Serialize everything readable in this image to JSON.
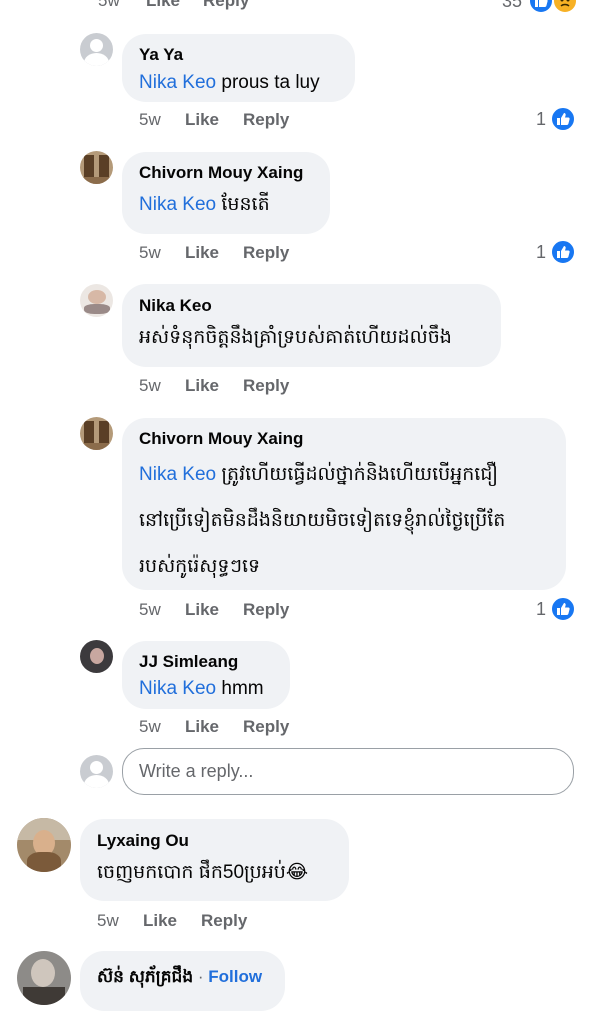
{
  "top_row": {
    "time": "5w",
    "like": "Like",
    "reply": "Reply",
    "count": "35",
    "reactions": [
      "like-icon",
      "sad-icon"
    ]
  },
  "comments": [
    {
      "name": "Ya Ya",
      "mention": "Nika Keo",
      "text": "prous ta luy",
      "time": "5w",
      "like": "Like",
      "reply": "Reply",
      "likes": "1",
      "avatar": "placeholder-avatar"
    },
    {
      "name": "Chivorn Mouy Xaing",
      "mention": "Nika Keo",
      "text": "មែនតើ",
      "time": "5w",
      "like": "Like",
      "reply": "Reply",
      "likes": "1",
      "avatar": "photo-avatar"
    },
    {
      "name": "Nika Keo",
      "mention": "",
      "text": "អស់ទំនុកចិត្តនឹងគ្រាំទ្របស់គាត់ហើយដល់ចឹង",
      "time": "5w",
      "like": "Like",
      "reply": "Reply",
      "likes": "",
      "avatar": "photo-avatar"
    },
    {
      "name": "Chivorn Mouy Xaing",
      "mention": "Nika Keo",
      "text_lines": [
        "ត្រូវហើយធ្វើដល់ថ្នាក់និងហើយបើអ្នកជឿ",
        "នៅប្រើទៀតមិនដឹងនិយាយមិចទៀតទេខ្ញុំរាល់ថ្ងៃប្រើតែ",
        "របស់កូរ៉េសុទ្ធៗទេ"
      ],
      "time": "5w",
      "like": "Like",
      "reply": "Reply",
      "likes": "1",
      "avatar": "photo-avatar"
    },
    {
      "name": "JJ Simleang",
      "mention": "Nika Keo",
      "text": "hmm",
      "time": "5w",
      "like": "Like",
      "reply": "Reply",
      "likes": "",
      "avatar": "photo-avatar"
    }
  ],
  "reply_box": {
    "placeholder": "Write a reply..."
  },
  "top_comment": {
    "name": "Lyxaing Ou",
    "text": "ចេញមកបោក ផឹក50ប្រអប់",
    "emoji": "😂",
    "time": "5w",
    "like": "Like",
    "reply": "Reply"
  },
  "bottom_comment": {
    "name": "ស៊ន់ សុភ័គ្រជឹង",
    "separator": "·",
    "follow": "Follow"
  },
  "colors": {
    "accent": "#1877f2",
    "mention": "#216fdb",
    "bubble": "#f0f2f5",
    "meta": "#65676b"
  }
}
